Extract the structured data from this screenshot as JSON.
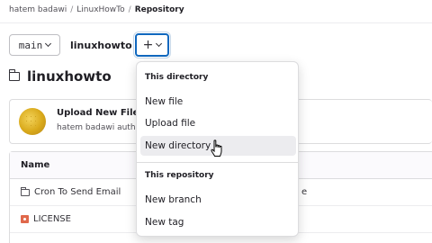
{
  "breadcrumb": {
    "items": [
      "hatem badawi",
      "LinuxHowTo",
      "Repository"
    ],
    "separator": "/"
  },
  "branch_selector": {
    "value": "main"
  },
  "path": {
    "repo": "linuxhowto",
    "separator": "/"
  },
  "add_button": {
    "label": "+"
  },
  "repo_title": "linuxhowto",
  "last_commit": {
    "title": "Upload New File",
    "author_line": "hatem badawi authored"
  },
  "files_table": {
    "header": "Name",
    "rows": [
      {
        "name": "Cron To Send Email",
        "icon": "folder-icon",
        "trailing": "e"
      },
      {
        "name": "LICENSE",
        "icon": "license-icon",
        "trailing": ""
      }
    ]
  },
  "dropdown": {
    "group1_title": "This directory",
    "group1_items": [
      "New file",
      "Upload file",
      "New directory"
    ],
    "group2_title": "This repository",
    "group2_items": [
      "New branch",
      "New tag"
    ],
    "hovered": "New directory"
  },
  "colors": {
    "focus_border": "#1068bf",
    "hover_bg": "#ececef"
  }
}
